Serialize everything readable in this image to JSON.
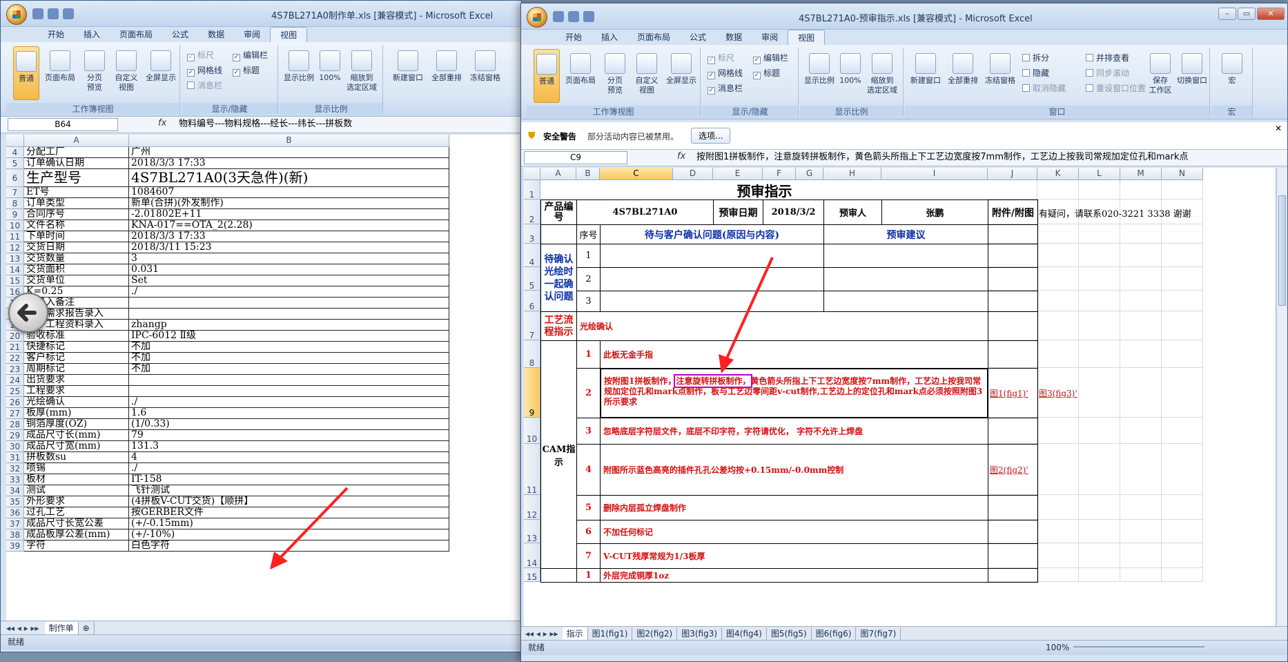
{
  "left": {
    "title": "4S7BL271A0制作单.xls  [兼容模式] - Microsoft Excel",
    "tabs": [
      "开始",
      "插入",
      "页面布局",
      "公式",
      "数据",
      "审阅",
      "视图"
    ],
    "active_tab": "视图",
    "ribbon": {
      "workbook_views": {
        "label": "工作簿视图",
        "normal": "普通",
        "page_layout": "页面布局",
        "page_break": "分页\n预览",
        "custom": "自定义\n视图",
        "fullscreen": "全屏显示"
      },
      "show_hide": {
        "label": "显示/隐藏",
        "ruler": "标尺",
        "gridlines": "网格线",
        "message_bar": "消息栏",
        "formula_bar": "编辑栏",
        "headings": "标题"
      },
      "zoom": {
        "label": "显示比例",
        "zoom": "显示比例",
        "zoom100": "100%",
        "zoom_sel": "缩放到\n选定区域"
      },
      "window": {
        "new": "新建窗口",
        "arrange": "全部重排",
        "freeze": "冻结窗格"
      }
    },
    "name_box": "B64",
    "fx": "fx",
    "formula": "物料编号---物料规格---经长---纬长---拼板数",
    "cols": [
      "A",
      "B"
    ],
    "rows": [
      {
        "n": "4",
        "a": "分配工厂",
        "b": "广州"
      },
      {
        "n": "5",
        "a": "订单确认日期",
        "b": "2018/3/3 17:33"
      },
      {
        "n": "6",
        "a": "生产型号",
        "b": "4S7BL271A0(3天急件)(新)"
      },
      {
        "n": "7",
        "a": "ET号",
        "b": "1084607"
      },
      {
        "n": "8",
        "a": "订单类型",
        "b": "新单(合拼)(外发制作)"
      },
      {
        "n": "9",
        "a": "合同序号",
        "b": "-2.01802E+11"
      },
      {
        "n": "10",
        "a": "文件名称",
        "b": "KNA-017==OTA_2(2.28)"
      },
      {
        "n": "11",
        "a": "下单时间",
        "b": "2018/3/3 17:33"
      },
      {
        "n": "12",
        "a": "交货日期",
        "b": "2018/3/11 15:23"
      },
      {
        "n": "13",
        "a": "交货数量",
        "b": "3"
      },
      {
        "n": "14",
        "a": "交货面积",
        "b": "0.031"
      },
      {
        "n": "15",
        "a": "交货单位",
        "b": "Set"
      },
      {
        "n": "16",
        "a": "K=0.25",
        "b": "./"
      },
      {
        "n": "17",
        "a": "单录入备注",
        "b": ""
      },
      {
        "n": "18",
        "a": "客户需求报告录入",
        "b": ""
      },
      {
        "n": "19",
        "a": "客户工程资料录入",
        "b": "zhangp"
      },
      {
        "n": "20",
        "a": "验收标准",
        "b": "IPC-6012 Ⅱ级"
      },
      {
        "n": "21",
        "a": "快捷标记",
        "b": "不加"
      },
      {
        "n": "22",
        "a": "客户标记",
        "b": "不加"
      },
      {
        "n": "23",
        "a": "周期标记",
        "b": "不加"
      },
      {
        "n": "24",
        "a": "出货要求",
        "b": ""
      },
      {
        "n": "25",
        "a": "工程要求",
        "b": ""
      },
      {
        "n": "26",
        "a": "光绘确认",
        "b": "./"
      },
      {
        "n": "27",
        "a": "板厚(mm)",
        "b": "1.6"
      },
      {
        "n": "28",
        "a": "铜箔厚度(OZ)",
        "b": "(1/0.33)"
      },
      {
        "n": "29",
        "a": "成品尺寸长(mm)",
        "b": "79"
      },
      {
        "n": "30",
        "a": "成品尺寸宽(mm)",
        "b": "131.3"
      },
      {
        "n": "31",
        "a": "拼板数su",
        "b": "4"
      },
      {
        "n": "32",
        "a": "喷锡",
        "b": "./"
      },
      {
        "n": "33",
        "a": "板材",
        "b": "IT-158"
      },
      {
        "n": "34",
        "a": "测试",
        "b": "飞针测试"
      },
      {
        "n": "35",
        "a": "外形要求",
        "b": "(4拼板V-CUT交货)【顺拼】"
      },
      {
        "n": "36",
        "a": "过孔工艺",
        "b": "按GERBER文件"
      },
      {
        "n": "37",
        "a": "成品尺寸长宽公差",
        "b": "(+/-0.15mm)"
      },
      {
        "n": "38",
        "a": "成品板厚公差(mm)",
        "b": "(+/-10%)"
      },
      {
        "n": "39",
        "a": "字符",
        "b": "白色字符"
      }
    ],
    "sheet_tab": "制作单",
    "status": "就绪"
  },
  "right": {
    "title": "4S7BL271A0-预审指示.xls  [兼容模式] - Microsoft Excel",
    "tabs": [
      "开始",
      "插入",
      "页面布局",
      "公式",
      "数据",
      "审阅",
      "视图"
    ],
    "active_tab": "视图",
    "ribbon": {
      "workbook_views": {
        "label": "工作簿视图",
        "normal": "普通",
        "page_layout": "页面布局",
        "page_break": "分页\n预览",
        "custom": "自定义\n视图",
        "fullscreen": "全屏显示"
      },
      "show_hide": {
        "label": "显示/隐藏",
        "ruler": "标尺",
        "gridlines": "网格线",
        "message_bar": "消息栏",
        "formula_bar": "编辑栏",
        "headings": "标题"
      },
      "zoom": {
        "label": "显示比例",
        "zoom": "显示比例",
        "zoom100": "100%",
        "zoom_sel": "缩放到\n选定区域"
      },
      "window": {
        "label": "窗口",
        "new": "新建窗口",
        "arrange": "全部重排",
        "freeze": "冻结窗格",
        "split": "拆分",
        "hide": "隐藏",
        "unhide": "取消隐藏",
        "side": "并排查看",
        "sync": "同步滚动",
        "reset": "重设窗口位置",
        "save_ws": "保存\n工作区",
        "switch": "切换窗口"
      },
      "macro": {
        "label": "宏",
        "macro": "宏"
      }
    },
    "security": {
      "label": "安全警告",
      "text": "部分活动内容已被禁用。",
      "button": "选项..."
    },
    "name_box": "C9",
    "fx": "fx",
    "formula": "按附图1拼板制作，注意旋转拼板制作，黄色箭头所指上下工艺边宽度按7mm制作，工艺边上按我司常规加定位孔和mark点",
    "cols": [
      "A",
      "B",
      "C",
      "D",
      "E",
      "F",
      "G",
      "H",
      "I",
      "J",
      "K",
      "L",
      "M",
      "N"
    ],
    "row_nums": [
      "1",
      "2",
      "3",
      "4",
      "5",
      "6",
      "7",
      "8",
      "9",
      "10",
      "11",
      "12",
      "13",
      "14",
      "15"
    ],
    "sheet": {
      "title": "预审指示",
      "product_label": "产品编号",
      "product_value": "4S7BL271A0",
      "date_label": "预审日期",
      "date_value": "2018/3/2",
      "reviewer_label": "预审人",
      "reviewer_value": "张鹏",
      "attach_label": "附件/附图",
      "contact": "有疑问，请联系020-3221 3338 谢谢",
      "seq_label": "序号",
      "issue_label": "待与客户确认问题(原因与内容)",
      "advice_label": "预审建议",
      "pending_label": "待确认光绘时一起确认问题",
      "pending_nums": [
        "1",
        "2",
        "3"
      ],
      "process_label": "工艺流程指示",
      "process_text": "光绘确认",
      "cam_label": "CAM指示",
      "cam_items": [
        {
          "n": "1",
          "text": "此板无金手指",
          "link": "",
          "link2": ""
        },
        {
          "n": "2",
          "pre": "按附图1拼板制作，",
          "hl": "注意旋转拼板制作，",
          "post": "黄色箭头所指上下工艺边宽度按7mm制作，工艺边上按我司常规加定位孔和mark点制作，板与工艺边零间距v-cut制作,工艺边上的定位孔和mark点必须按照附图3所示要求",
          "link": "图1(fig1)'",
          "link2": "图3(fig3)'"
        },
        {
          "n": "3",
          "text": "忽略底层字符层文件，底层不印字符，字符请优化，  字符不允许上焊盘",
          "link": "",
          "link2": ""
        },
        {
          "n": "4",
          "text": "附图所示蓝色高亮的插件孔孔公差均按+0.15mm/-0.0mm控制",
          "link": "图2(fig2)'",
          "link2": ""
        },
        {
          "n": "5",
          "text": "删除内层孤立焊盘制作",
          "link": "",
          "link2": ""
        },
        {
          "n": "6",
          "text": "不加任何标记",
          "link": "",
          "link2": ""
        },
        {
          "n": "7",
          "text": "V-CUT残厚常规为1/3板厚",
          "link": "",
          "link2": ""
        }
      ],
      "next_n": "1",
      "next_text": "外层完成铜厚1oz"
    },
    "sheet_tabs": [
      "指示",
      "图1(fig1)",
      "图2(fig2)",
      "图3(fig3)",
      "图4(fig4)",
      "图5(fig5)",
      "图6(fig6)",
      "图7(fig7)"
    ],
    "status": "就绪",
    "zoom": "100%"
  },
  "colors": {
    "accent_red": "#d31010",
    "accent_blue": "#0b2fa8",
    "highlight": "#c000c0",
    "arrow": "#ff2020"
  }
}
